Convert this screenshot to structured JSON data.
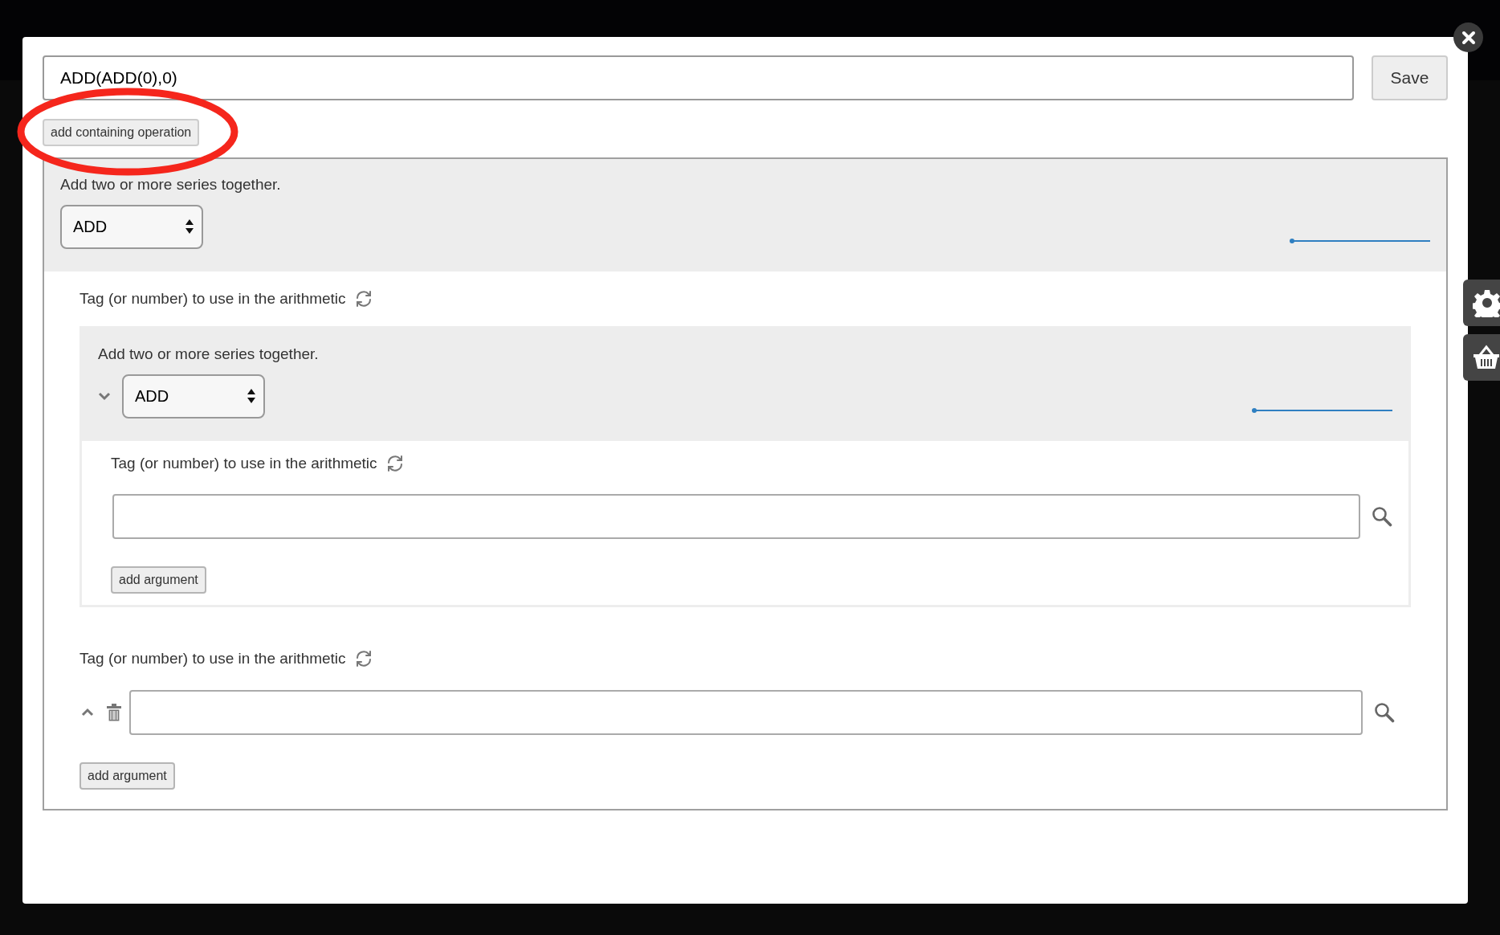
{
  "expression_field": {
    "value": "ADD(ADD(0),0)"
  },
  "save_button": "Save",
  "add_containing_operation_button": "add containing operation",
  "operation": {
    "description": "Add two or more series together.",
    "selected_operation": "ADD",
    "arguments": [
      {
        "kind": "operation",
        "label": "Tag (or number) to use in the arithmetic",
        "operation": {
          "description": "Add two or more series together.",
          "selected_operation": "ADD",
          "can_move_down": true,
          "arguments": [
            {
              "kind": "tag",
              "label": "Tag (or number) to use in the arithmetic"
            }
          ],
          "add_argument_button": "add argument"
        }
      },
      {
        "kind": "tag",
        "label": "Tag (or number) to use in the arithmetic",
        "can_move_up": true,
        "deletable": true
      }
    ],
    "add_argument_button": "add argument"
  }
}
